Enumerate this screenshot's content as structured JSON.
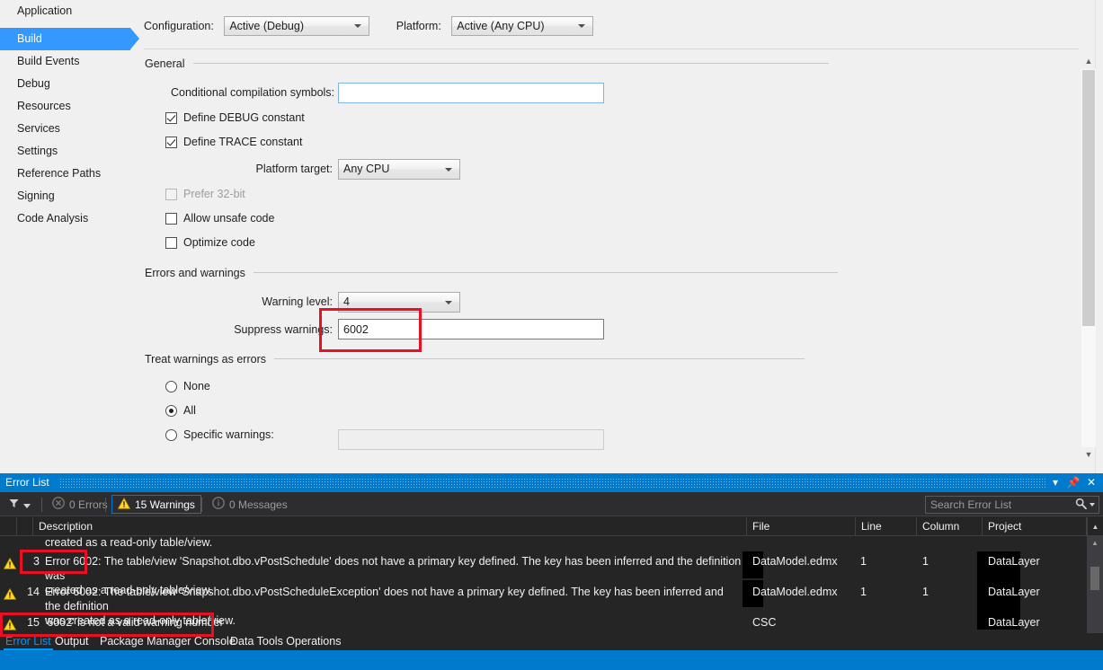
{
  "designer": {
    "categories": [
      {
        "label": "Application",
        "selected": false
      },
      {
        "label": "Build",
        "selected": true
      },
      {
        "label": "Build Events",
        "selected": false
      },
      {
        "label": "Debug",
        "selected": false
      },
      {
        "label": "Resources",
        "selected": false
      },
      {
        "label": "Services",
        "selected": false
      },
      {
        "label": "Settings",
        "selected": false
      },
      {
        "label": "Reference Paths",
        "selected": false
      },
      {
        "label": "Signing",
        "selected": false
      },
      {
        "label": "Code Analysis",
        "selected": false
      }
    ],
    "configuration": {
      "label": "Configuration:",
      "value": "Active (Debug)"
    },
    "platform": {
      "label": "Platform:",
      "value": "Active (Any CPU)"
    },
    "groups": {
      "general": "General",
      "errors_and_warnings": "Errors and warnings",
      "treat_warnings_as_errors": "Treat warnings as errors"
    },
    "general": {
      "conditional_symbols_label": "Conditional compilation symbols:",
      "conditional_symbols_value": "",
      "define_debug_label": "Define DEBUG constant",
      "define_debug_checked": true,
      "define_trace_label": "Define TRACE constant",
      "define_trace_checked": true,
      "platform_target_label": "Platform target:",
      "platform_target_value": "Any CPU",
      "prefer32_label": "Prefer 32-bit",
      "prefer32_checked": false,
      "allow_unsafe_label": "Allow unsafe code",
      "allow_unsafe_checked": false,
      "optimize_label": "Optimize code",
      "optimize_checked": false
    },
    "errors_warnings": {
      "warning_level_label": "Warning level:",
      "warning_level_value": "4",
      "suppress_warnings_label": "Suppress warnings:",
      "suppress_warnings_value": "6002"
    },
    "treat_warnings": {
      "none_label": "None",
      "none_selected": false,
      "all_label": "All",
      "all_selected": true,
      "specific_label": "Specific warnings:",
      "specific_selected": false,
      "specific_value": ""
    }
  },
  "error_list": {
    "title": "Error List",
    "toolbar": {
      "errors_label": "0 Errors",
      "warnings_label": "15 Warnings",
      "messages_label": "0 Messages"
    },
    "search_placeholder": "Search Error List",
    "columns": {
      "description": "Description",
      "file": "File",
      "line": "Line",
      "column": "Column",
      "project": "Project"
    },
    "top_fragment": "created as a read-only table/view.",
    "rows": [
      {
        "num": "3",
        "description": "Error 6002: The table/view 'Snapshot.dbo.vPostSchedule' does not have a primary key defined. The key has been inferred and the definition was",
        "description_cont": "created as a read-only table/view.",
        "file": "DataModel.edmx",
        "line": "1",
        "column": "1",
        "project": "DataLayer"
      },
      {
        "num": "14",
        "description": "Error 6002: The table/view 'Snapshot.dbo.vPostScheduleException' does not have a primary key defined. The key has been inferred and the definition",
        "description_cont": "was created as a read-only table/view.",
        "file": "DataModel.edmx",
        "line": "1",
        "column": "1",
        "project": "DataLayer"
      },
      {
        "num": "15",
        "description": "'6002' is not a valid warning number",
        "description_cont": "",
        "file": "CSC",
        "line": "",
        "column": "",
        "project": "DataLayer"
      }
    ],
    "tabs": [
      {
        "label": "Error List",
        "active": true
      },
      {
        "label": "Output",
        "active": false
      },
      {
        "label": "Package Manager Console",
        "active": false
      },
      {
        "label": "Data Tools Operations",
        "active": false
      }
    ]
  },
  "colors": {
    "accent_blue": "#007acc",
    "selection_blue": "#3399ff",
    "annotation_red": "#e81123",
    "warning_yellow": "#ffd527",
    "panel_dark": "#252526",
    "toolbar_dark": "#2d2d30"
  }
}
